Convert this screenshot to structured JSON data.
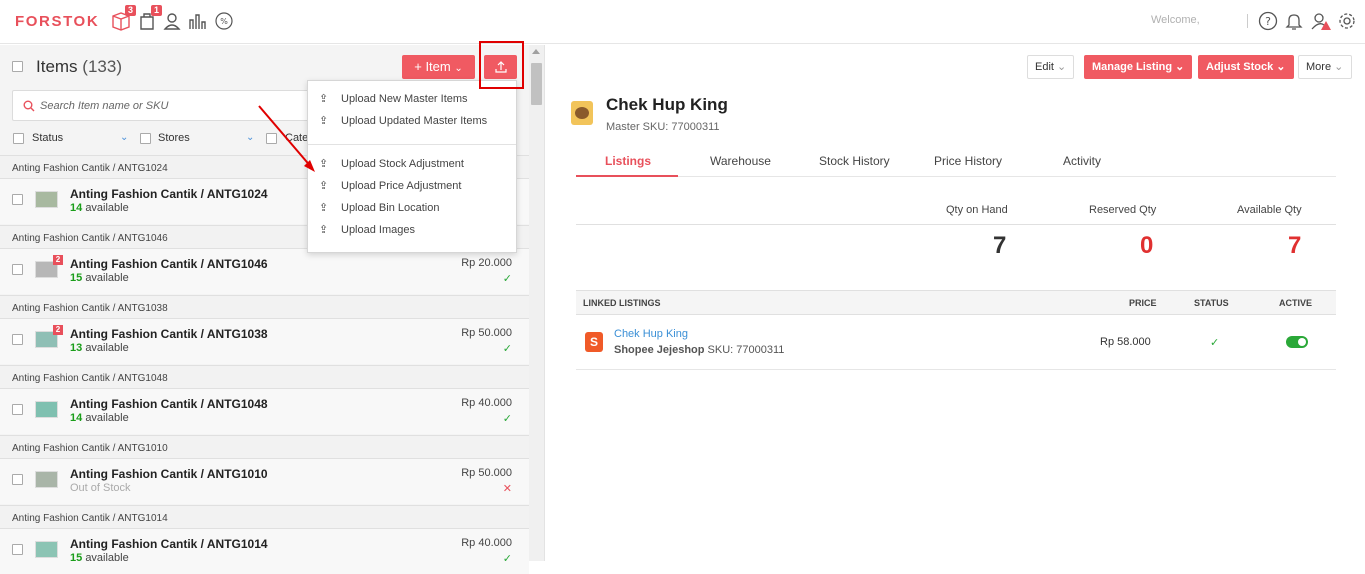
{
  "app": {
    "logo": "FORSTOK",
    "welcome": "Welcome,"
  },
  "topnav": {
    "orders_badge": "3",
    "bag_badge": "1"
  },
  "items_panel": {
    "title": "Items",
    "count": "(133)",
    "add_button": "+ Item",
    "search_placeholder": "Search Item name or SKU",
    "filters": [
      "Status",
      "Stores",
      "Categ"
    ],
    "rows": [
      {
        "group": "Anting Fashion Cantik / ANTG1024",
        "name": "Anting Fashion Cantik / ANTG1024",
        "qty": "14",
        "avail": "available",
        "price": "",
        "status": "",
        "badge": ""
      },
      {
        "group": "Anting Fashion Cantik / ANTG1046",
        "name": "Anting Fashion Cantik / ANTG1046",
        "qty": "15",
        "avail": "available",
        "price": "Rp 20.000",
        "status": "✓",
        "badge": "2"
      },
      {
        "group": "Anting Fashion Cantik / ANTG1038",
        "name": "Anting Fashion Cantik / ANTG1038",
        "qty": "13",
        "avail": "available",
        "price": "Rp 50.000",
        "status": "✓",
        "badge": "2"
      },
      {
        "group": "Anting Fashion Cantik / ANTG1048",
        "name": "Anting Fashion Cantik / ANTG1048",
        "qty": "14",
        "avail": "available",
        "price": "Rp 40.000",
        "status": "✓",
        "badge": ""
      },
      {
        "group": "Anting Fashion Cantik / ANTG1010",
        "name": "Anting Fashion Cantik / ANTG1010",
        "qty": "",
        "avail": "Out of Stock",
        "price": "Rp 50.000",
        "status": "✕",
        "badge": ""
      },
      {
        "group": "Anting Fashion Cantik / ANTG1014",
        "name": "Anting Fashion Cantik / ANTG1014",
        "qty": "15",
        "avail": "available",
        "price": "Rp 40.000",
        "status": "✓",
        "badge": ""
      }
    ]
  },
  "upload_menu": {
    "items": [
      "Upload New Master Items",
      "Upload Updated Master Items",
      "Upload Stock Adjustment",
      "Upload Price Adjustment",
      "Upload Bin Location",
      "Upload Images"
    ]
  },
  "detail": {
    "toolbar": {
      "edit": "Edit",
      "manage_listing": "Manage Listing",
      "adjust_stock": "Adjust Stock",
      "more": "More"
    },
    "product_name": "Chek Hup King",
    "master_sku": "Master SKU: 77000311",
    "tabs": [
      "Listings",
      "Warehouse",
      "Stock History",
      "Price History",
      "Activity"
    ],
    "qty": {
      "on_hand_label": "Qty on Hand",
      "on_hand": "7",
      "reserved_label": "Reserved Qty",
      "reserved": "0",
      "available_label": "Available Qty",
      "available": "7"
    },
    "listings": {
      "headers": {
        "linked": "LINKED LISTINGS",
        "price": "PRICE",
        "status": "STATUS",
        "active": "ACTIVE"
      },
      "row": {
        "title": "Chek Hup King",
        "store": "Shopee Jejeshop",
        "sku": " SKU: 77000311",
        "price": "Rp  58.000",
        "status": "✓"
      }
    }
  },
  "colors": {
    "brand": "#e8505b",
    "ok": "#2aa838"
  }
}
